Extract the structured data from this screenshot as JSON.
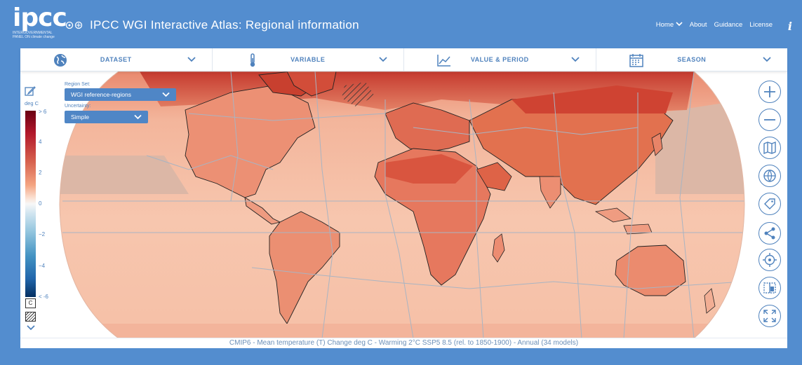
{
  "header": {
    "logo_text": "ipcc",
    "logo_subtext": "INTERGOVERNMENTAL PANEL ON climate change",
    "title": "IPCC WGI Interactive Atlas: Regional information",
    "nav": {
      "home": "Home",
      "about": "About",
      "guidance": "Guidance",
      "license": "License"
    }
  },
  "toolbar": [
    {
      "label": "DATASET",
      "icon": "globe-icon"
    },
    {
      "label": "VARIABLE",
      "icon": "thermometer-icon"
    },
    {
      "label": "VALUE & PERIOD",
      "icon": "line-chart-icon"
    },
    {
      "label": "SEASON",
      "icon": "calendar-icon"
    }
  ],
  "region_set": {
    "label": "Region Set:",
    "value": "WGI reference-regions"
  },
  "uncertainty": {
    "label": "Uncertainty:",
    "value": "Simple"
  },
  "legend": {
    "units": "deg C",
    "ticks": [
      "> 6",
      "4",
      "2",
      "0",
      "−2",
      "−4",
      "< -6"
    ],
    "c_label": "C"
  },
  "caption": "CMIP6 - Mean temperature (T) Change deg C - Warming 2°C SSP5 8.5 (rel. to 1850-1900) - Annual (34 models)",
  "map_colors": {
    "ocean": "#f6c1aa",
    "land_hot": "#d9503e",
    "land_warm": "#ec8f73",
    "neutral_ocean": "#dcb7a6",
    "borders": "#a9b4c2"
  },
  "right_tools": [
    "zoom-in-icon",
    "zoom-out-icon",
    "map-icon",
    "globe-network-icon",
    "tag-icon",
    "share-icon",
    "target-icon",
    "split-view-icon",
    "fullscreen-icon"
  ]
}
